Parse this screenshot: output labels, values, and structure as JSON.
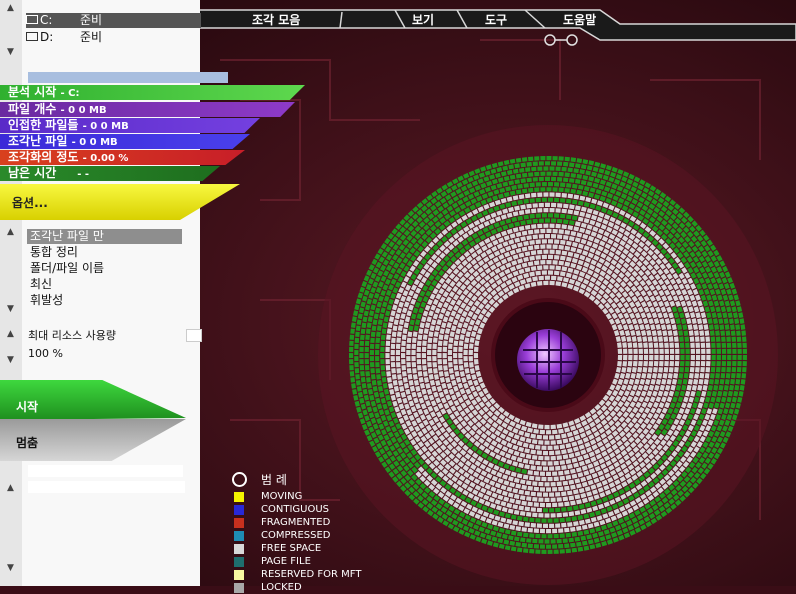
{
  "drives": [
    {
      "letter": "C:",
      "status": "준비",
      "selected": true
    },
    {
      "letter": "D:",
      "status": "준비",
      "selected": false
    }
  ],
  "menu": [
    "조각 모음",
    "보기",
    "도구",
    "도움말"
  ],
  "stats": {
    "analysis_label": "분석 시작",
    "analysis_value": "- C:",
    "file_count_label": "파일 개수",
    "file_count_value": "-          0         0 MB",
    "contiguous_label": "인접한 파일들",
    "contiguous_value": "-  0         0 MB",
    "fragmented_label": "조각난 파일",
    "fragmented_value": "-  0         0 MB",
    "degree_label": "조각화의 정도",
    "degree_value": "- 0.00 %",
    "remaining_label": "남은 시간",
    "remaining_value": "- -"
  },
  "options_label": "옵션...",
  "modes": [
    "조각난 파일 만",
    "통합 정리",
    "폴더/파일 이름",
    "최신",
    "휘발성"
  ],
  "resource": {
    "label": "최대 리소스 사용량",
    "value": "100 %"
  },
  "start_label": "시작",
  "stop_label": "멈춤",
  "legend": {
    "title": "범 례",
    "items": [
      {
        "label": "MOVING",
        "color": "#f5f300"
      },
      {
        "label": "CONTIGUOUS",
        "color": "#2828d8"
      },
      {
        "label": "FRAGMENTED",
        "color": "#c8301e"
      },
      {
        "label": "COMPRESSED",
        "color": "#1e8cb4"
      },
      {
        "label": "FREE SPACE",
        "color": "#d8d8d8"
      },
      {
        "label": "PAGE FILE",
        "color": "#1e6e6e"
      },
      {
        "label": "RESERVED FOR MFT",
        "color": "#f8f8a0"
      },
      {
        "label": "LOCKED",
        "color": "#a8a8a8"
      }
    ]
  },
  "colors": {
    "used": "#1f9a1f",
    "free": "#d6d6d6",
    "bg": "#3a0d16"
  }
}
